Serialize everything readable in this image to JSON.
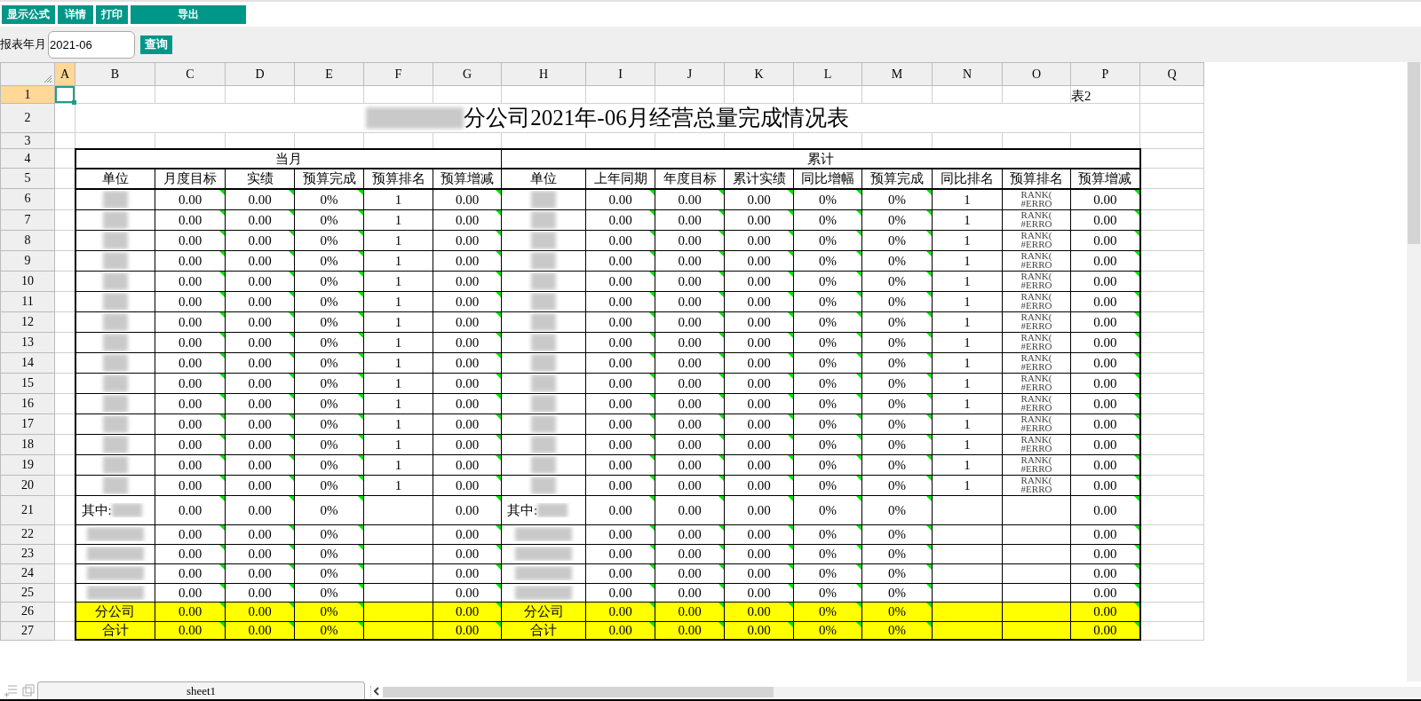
{
  "toolbar": {
    "buttons": [
      "显示公式",
      "详情",
      "打印",
      "导出"
    ]
  },
  "filter": {
    "label": "报表年月",
    "value": "2021-06",
    "button": "查询"
  },
  "sheet": {
    "columns": [
      {
        "label": "A",
        "selected": true
      },
      {
        "label": "B",
        "selected": false
      },
      {
        "label": "C",
        "selected": false
      },
      {
        "label": "D",
        "selected": false
      },
      {
        "label": "E",
        "selected": false
      },
      {
        "label": "F",
        "selected": false
      },
      {
        "label": "G",
        "selected": false
      },
      {
        "label": "H",
        "selected": false
      },
      {
        "label": "I",
        "selected": false
      },
      {
        "label": "J",
        "selected": false
      },
      {
        "label": "K",
        "selected": false
      },
      {
        "label": "L",
        "selected": false
      },
      {
        "label": "M",
        "selected": false
      },
      {
        "label": "N",
        "selected": false
      },
      {
        "label": "O",
        "selected": false
      },
      {
        "label": "P",
        "selected": false
      },
      {
        "label": "Q",
        "selected": false
      }
    ],
    "row_numbers": [
      {
        "label": "1",
        "selected": true
      },
      {
        "label": "2",
        "selected": false
      },
      {
        "label": "3",
        "selected": false
      },
      {
        "label": "4",
        "selected": false
      },
      {
        "label": "5",
        "selected": false
      },
      {
        "label": "6",
        "selected": false
      },
      {
        "label": "7",
        "selected": false
      },
      {
        "label": "8",
        "selected": false
      },
      {
        "label": "9",
        "selected": false
      },
      {
        "label": "10",
        "selected": false
      },
      {
        "label": "11",
        "selected": false
      },
      {
        "label": "12",
        "selected": false
      },
      {
        "label": "13",
        "selected": false
      },
      {
        "label": "14",
        "selected": false
      },
      {
        "label": "15",
        "selected": false
      },
      {
        "label": "16",
        "selected": false
      },
      {
        "label": "17",
        "selected": false
      },
      {
        "label": "18",
        "selected": false
      },
      {
        "label": "19",
        "selected": false
      },
      {
        "label": "20",
        "selected": false
      },
      {
        "label": "21",
        "selected": false
      },
      {
        "label": "22",
        "selected": false
      },
      {
        "label": "23",
        "selected": false
      },
      {
        "label": "24",
        "selected": false
      },
      {
        "label": "25",
        "selected": false
      },
      {
        "label": "26",
        "selected": false
      },
      {
        "label": "27",
        "selected": false
      }
    ],
    "table_number": "表2",
    "title": {
      "text": "分公司2021年-06月经营总量完成情况表",
      "redacted_prefix": true
    },
    "groups": [
      "当月",
      "累计"
    ],
    "headers_month": [
      "单位",
      "月度目标",
      "实绩",
      "预算完成",
      "预算排名",
      "预算增减"
    ],
    "headers_cumulative": [
      "单位",
      "上年同期",
      "年度目标",
      "累计实绩",
      "同比增幅",
      "预算完成",
      "同比排名",
      "预算排名",
      "预算增减"
    ],
    "data_rows": [
      {
        "highlight": false,
        "unit": {
          "redacted": true
        },
        "month": {
          "target": "0.00",
          "actual": "0.00",
          "completion": "0%",
          "rank": "1",
          "change": "0.00"
        },
        "cumulative": {
          "unit": {
            "redacted": true
          },
          "last_year": "0.00",
          "annual_target": "0.00",
          "actual": "0.00",
          "yoy": "0%",
          "completion": "0%",
          "yoy_rank": "1",
          "budget_rank": "RANK( #ERRO",
          "change": "0.00"
        }
      },
      {
        "highlight": false,
        "unit": {
          "redacted": true
        },
        "month": {
          "target": "0.00",
          "actual": "0.00",
          "completion": "0%",
          "rank": "1",
          "change": "0.00"
        },
        "cumulative": {
          "unit": {
            "redacted": true
          },
          "last_year": "0.00",
          "annual_target": "0.00",
          "actual": "0.00",
          "yoy": "0%",
          "completion": "0%",
          "yoy_rank": "1",
          "budget_rank": "RANK( #ERRO",
          "change": "0.00"
        }
      },
      {
        "highlight": false,
        "unit": {
          "redacted": true
        },
        "month": {
          "target": "0.00",
          "actual": "0.00",
          "completion": "0%",
          "rank": "1",
          "change": "0.00"
        },
        "cumulative": {
          "unit": {
            "redacted": true
          },
          "last_year": "0.00",
          "annual_target": "0.00",
          "actual": "0.00",
          "yoy": "0%",
          "completion": "0%",
          "yoy_rank": "1",
          "budget_rank": "RANK( #ERRO",
          "change": "0.00"
        }
      },
      {
        "highlight": false,
        "unit": {
          "redacted": true
        },
        "month": {
          "target": "0.00",
          "actual": "0.00",
          "completion": "0%",
          "rank": "1",
          "change": "0.00"
        },
        "cumulative": {
          "unit": {
            "redacted": true
          },
          "last_year": "0.00",
          "annual_target": "0.00",
          "actual": "0.00",
          "yoy": "0%",
          "completion": "0%",
          "yoy_rank": "1",
          "budget_rank": "RANK( #ERRO",
          "change": "0.00"
        }
      },
      {
        "highlight": false,
        "unit": {
          "redacted": true
        },
        "month": {
          "target": "0.00",
          "actual": "0.00",
          "completion": "0%",
          "rank": "1",
          "change": "0.00"
        },
        "cumulative": {
          "unit": {
            "redacted": true
          },
          "last_year": "0.00",
          "annual_target": "0.00",
          "actual": "0.00",
          "yoy": "0%",
          "completion": "0%",
          "yoy_rank": "1",
          "budget_rank": "RANK( #ERRO",
          "change": "0.00"
        }
      },
      {
        "highlight": false,
        "unit": {
          "redacted": true
        },
        "month": {
          "target": "0.00",
          "actual": "0.00",
          "completion": "0%",
          "rank": "1",
          "change": "0.00"
        },
        "cumulative": {
          "unit": {
            "redacted": true
          },
          "last_year": "0.00",
          "annual_target": "0.00",
          "actual": "0.00",
          "yoy": "0%",
          "completion": "0%",
          "yoy_rank": "1",
          "budget_rank": "RANK( #ERRO",
          "change": "0.00"
        }
      },
      {
        "highlight": false,
        "unit": {
          "redacted": true
        },
        "month": {
          "target": "0.00",
          "actual": "0.00",
          "completion": "0%",
          "rank": "1",
          "change": "0.00"
        },
        "cumulative": {
          "unit": {
            "redacted": true
          },
          "last_year": "0.00",
          "annual_target": "0.00",
          "actual": "0.00",
          "yoy": "0%",
          "completion": "0%",
          "yoy_rank": "1",
          "budget_rank": "RANK( #ERRO",
          "change": "0.00"
        }
      },
      {
        "highlight": false,
        "unit": {
          "redacted": true
        },
        "month": {
          "target": "0.00",
          "actual": "0.00",
          "completion": "0%",
          "rank": "1",
          "change": "0.00"
        },
        "cumulative": {
          "unit": {
            "redacted": true
          },
          "last_year": "0.00",
          "annual_target": "0.00",
          "actual": "0.00",
          "yoy": "0%",
          "completion": "0%",
          "yoy_rank": "1",
          "budget_rank": "RANK( #ERRO",
          "change": "0.00"
        }
      },
      {
        "highlight": false,
        "unit": {
          "redacted": true
        },
        "month": {
          "target": "0.00",
          "actual": "0.00",
          "completion": "0%",
          "rank": "1",
          "change": "0.00"
        },
        "cumulative": {
          "unit": {
            "redacted": true
          },
          "last_year": "0.00",
          "annual_target": "0.00",
          "actual": "0.00",
          "yoy": "0%",
          "completion": "0%",
          "yoy_rank": "1",
          "budget_rank": "RANK( #ERRO",
          "change": "0.00"
        }
      },
      {
        "highlight": false,
        "unit": {
          "redacted": true
        },
        "month": {
          "target": "0.00",
          "actual": "0.00",
          "completion": "0%",
          "rank": "1",
          "change": "0.00"
        },
        "cumulative": {
          "unit": {
            "redacted": true
          },
          "last_year": "0.00",
          "annual_target": "0.00",
          "actual": "0.00",
          "yoy": "0%",
          "completion": "0%",
          "yoy_rank": "1",
          "budget_rank": "RANK( #ERRO",
          "change": "0.00"
        }
      },
      {
        "highlight": false,
        "unit": {
          "redacted": true
        },
        "month": {
          "target": "0.00",
          "actual": "0.00",
          "completion": "0%",
          "rank": "1",
          "change": "0.00"
        },
        "cumulative": {
          "unit": {
            "redacted": true
          },
          "last_year": "0.00",
          "annual_target": "0.00",
          "actual": "0.00",
          "yoy": "0%",
          "completion": "0%",
          "yoy_rank": "1",
          "budget_rank": "RANK( #ERRO",
          "change": "0.00"
        }
      },
      {
        "highlight": false,
        "unit": {
          "redacted": true
        },
        "month": {
          "target": "0.00",
          "actual": "0.00",
          "completion": "0%",
          "rank": "1",
          "change": "0.00"
        },
        "cumulative": {
          "unit": {
            "redacted": true
          },
          "last_year": "0.00",
          "annual_target": "0.00",
          "actual": "0.00",
          "yoy": "0%",
          "completion": "0%",
          "yoy_rank": "1",
          "budget_rank": "RANK( #ERRO",
          "change": "0.00"
        }
      },
      {
        "highlight": false,
        "unit": {
          "redacted": true
        },
        "month": {
          "target": "0.00",
          "actual": "0.00",
          "completion": "0%",
          "rank": "1",
          "change": "0.00"
        },
        "cumulative": {
          "unit": {
            "redacted": true
          },
          "last_year": "0.00",
          "annual_target": "0.00",
          "actual": "0.00",
          "yoy": "0%",
          "completion": "0%",
          "yoy_rank": "1",
          "budget_rank": "RANK( #ERRO",
          "change": "0.00"
        }
      },
      {
        "highlight": false,
        "unit": {
          "redacted": true
        },
        "month": {
          "target": "0.00",
          "actual": "0.00",
          "completion": "0%",
          "rank": "1",
          "change": "0.00"
        },
        "cumulative": {
          "unit": {
            "redacted": true
          },
          "last_year": "0.00",
          "annual_target": "0.00",
          "actual": "0.00",
          "yoy": "0%",
          "completion": "0%",
          "yoy_rank": "1",
          "budget_rank": "RANK( #ERRO",
          "change": "0.00"
        }
      },
      {
        "highlight": false,
        "unit": {
          "redacted": true
        },
        "month": {
          "target": "0.00",
          "actual": "0.00",
          "completion": "0%",
          "rank": "1",
          "change": "0.00"
        },
        "cumulative": {
          "unit": {
            "redacted": true
          },
          "last_year": "0.00",
          "annual_target": "0.00",
          "actual": "0.00",
          "yoy": "0%",
          "completion": "0%",
          "yoy_rank": "1",
          "budget_rank": "RANK( #ERRO",
          "change": "0.00"
        }
      },
      {
        "highlight": false,
        "unit": {
          "text": "其中:",
          "redacted": true
        },
        "month": {
          "target": "0.00",
          "actual": "0.00",
          "completion": "0%",
          "change": "0.00"
        },
        "cumulative": {
          "unit": {
            "text": "其中:",
            "redacted": true
          },
          "last_year": "0.00",
          "annual_target": "0.00",
          "actual": "0.00",
          "yoy": "0%",
          "completion": "0%",
          "change": "0.00"
        }
      },
      {
        "highlight": false,
        "unit": {
          "redacted": true
        },
        "month": {
          "target": "0.00",
          "actual": "0.00",
          "completion": "0%",
          "change": "0.00"
        },
        "cumulative": {
          "unit": {
            "redacted": true
          },
          "last_year": "0.00",
          "annual_target": "0.00",
          "actual": "0.00",
          "yoy": "0%",
          "completion": "0%",
          "change": "0.00"
        }
      },
      {
        "highlight": false,
        "unit": {
          "redacted": true
        },
        "month": {
          "target": "0.00",
          "actual": "0.00",
          "completion": "0%",
          "change": "0.00"
        },
        "cumulative": {
          "unit": {
            "redacted": true
          },
          "last_year": "0.00",
          "annual_target": "0.00",
          "actual": "0.00",
          "yoy": "0%",
          "completion": "0%",
          "change": "0.00"
        }
      },
      {
        "highlight": false,
        "unit": {
          "redacted": true
        },
        "month": {
          "target": "0.00",
          "actual": "0.00",
          "completion": "0%",
          "change": "0.00"
        },
        "cumulative": {
          "unit": {
            "redacted": true
          },
          "last_year": "0.00",
          "annual_target": "0.00",
          "actual": "0.00",
          "yoy": "0%",
          "completion": "0%",
          "change": "0.00"
        }
      },
      {
        "highlight": false,
        "unit": {
          "redacted": true
        },
        "month": {
          "target": "0.00",
          "actual": "0.00",
          "completion": "0%",
          "change": "0.00"
        },
        "cumulative": {
          "unit": {
            "redacted": true
          },
          "last_year": "0.00",
          "annual_target": "0.00",
          "actual": "0.00",
          "yoy": "0%",
          "completion": "0%",
          "change": "0.00"
        }
      },
      {
        "highlight": true,
        "unit": {
          "text": "分公司",
          "redacted": false
        },
        "month": {
          "target": "0.00",
          "actual": "0.00",
          "completion": "0%",
          "change": "0.00"
        },
        "cumulative": {
          "unit": {
            "text": "分公司",
            "redacted": false
          },
          "last_year": "0.00",
          "annual_target": "0.00",
          "actual": "0.00",
          "yoy": "0%",
          "completion": "0%",
          "change": "0.00"
        }
      },
      {
        "highlight": true,
        "unit": {
          "text": "合计",
          "redacted": false
        },
        "month": {
          "target": "0.00",
          "actual": "0.00",
          "completion": "0%",
          "change": "0.00"
        },
        "cumulative": {
          "unit": {
            "text": "合计",
            "redacted": false
          },
          "last_year": "0.00",
          "annual_target": "0.00",
          "actual": "0.00",
          "yoy": "0%",
          "completion": "0%",
          "change": "0.00"
        }
      }
    ]
  },
  "sheet_tabs": [
    {
      "label": "sheet1",
      "selected": true
    }
  ]
}
